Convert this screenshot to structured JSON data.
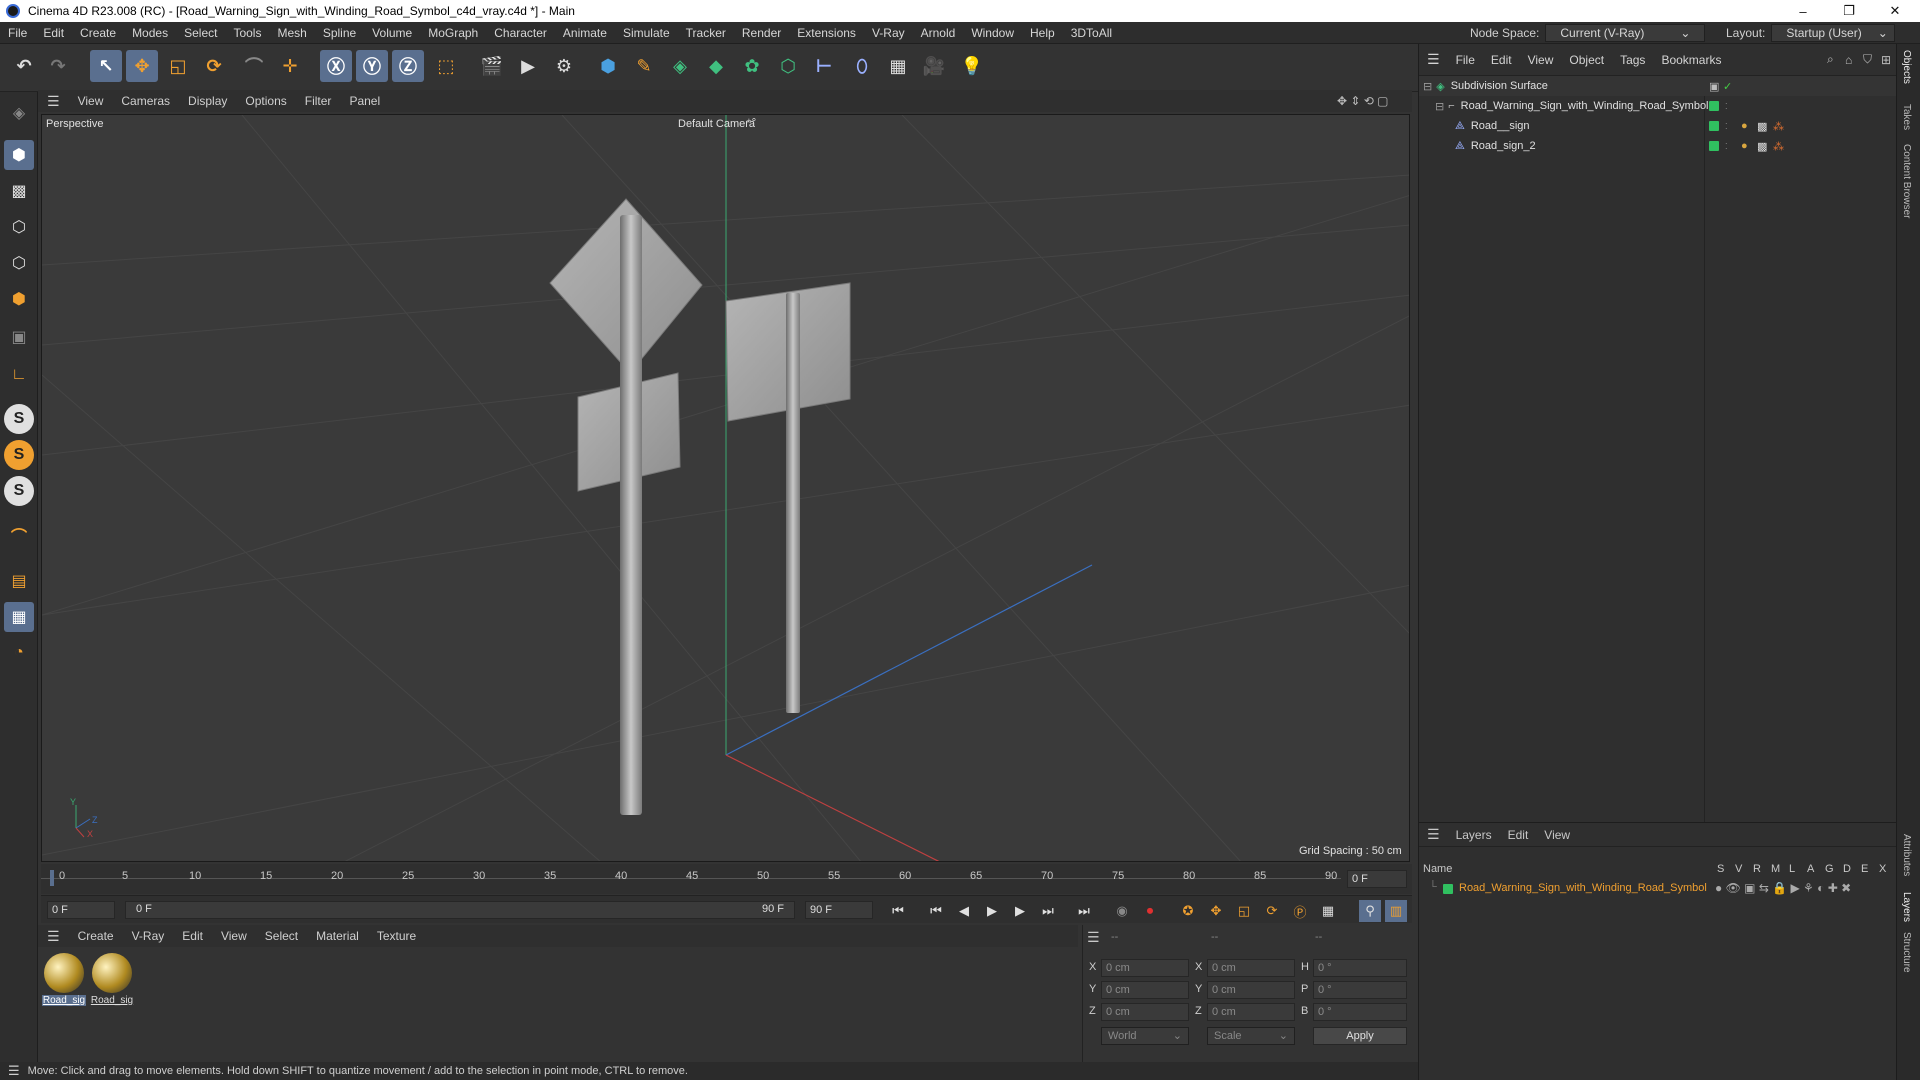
{
  "window": {
    "title": "Cinema 4D R23.008 (RC) - [Road_Warning_Sign_with_Winding_Road_Symbol_c4d_vray.c4d *] - Main",
    "minimize": "–",
    "maximize": "❐",
    "close": "✕"
  },
  "menu": [
    "File",
    "Edit",
    "Create",
    "Modes",
    "Select",
    "Tools",
    "Mesh",
    "Spline",
    "Volume",
    "MoGraph",
    "Character",
    "Animate",
    "Simulate",
    "Tracker",
    "Render",
    "Extensions",
    "V-Ray",
    "Arnold",
    "Window",
    "Help",
    "3DToAll"
  ],
  "node_space": {
    "label": "Node Space:",
    "value": "Current (V-Ray)"
  },
  "layout": {
    "label": "Layout:",
    "value": "Startup (User)"
  },
  "viewport": {
    "menu": [
      "View",
      "Cameras",
      "Display",
      "Options",
      "Filter",
      "Panel"
    ],
    "name": "Perspective",
    "camera": "Default Camera",
    "grid_spacing": "Grid Spacing : 50 cm",
    "axis_y": "Y",
    "axis_z": "Z",
    "axis_x": "X"
  },
  "timeline": {
    "ticks": [
      "0",
      "5",
      "10",
      "15",
      "20",
      "25",
      "30",
      "35",
      "40",
      "45",
      "50",
      "55",
      "60",
      "65",
      "70",
      "75",
      "80",
      "85",
      "90"
    ],
    "current_frame": "0 F"
  },
  "transport": {
    "start": "0 F",
    "range_start": "0 F",
    "range_end": "90 F",
    "end": "90 F"
  },
  "material_menu": [
    "Create",
    "V-Ray",
    "Edit",
    "View",
    "Select",
    "Material",
    "Texture"
  ],
  "materials": [
    {
      "label": "Road_sig",
      "selected": true
    },
    {
      "label": "Road_sig",
      "selected": false
    }
  ],
  "coords": {
    "header": [
      "--",
      "--",
      "--"
    ],
    "rows": [
      {
        "a": "X",
        "av": "0 cm",
        "b": "X",
        "bv": "0 cm",
        "c": "H",
        "cv": "0 °"
      },
      {
        "a": "Y",
        "av": "0 cm",
        "b": "Y",
        "bv": "0 cm",
        "c": "P",
        "cv": "0 °"
      },
      {
        "a": "Z",
        "av": "0 cm",
        "b": "Z",
        "bv": "0 cm",
        "c": "B",
        "cv": "0 °"
      }
    ],
    "space": "World",
    "mode": "Scale",
    "apply": "Apply"
  },
  "status": "Move: Click and drag to move elements. Hold down SHIFT to quantize movement / add to the selection in point mode, CTRL to remove.",
  "objects": {
    "menu": [
      "File",
      "Edit",
      "View",
      "Object",
      "Tags",
      "Bookmarks"
    ],
    "items": [
      {
        "name": "Subdivision Surface",
        "level": 0
      },
      {
        "name": "Road_Warning_Sign_with_Winding_Road_Symbol",
        "level": 1
      },
      {
        "name": "Road__sign",
        "level": 2
      },
      {
        "name": "Road_sign_2",
        "level": 2
      }
    ]
  },
  "layers": {
    "menu": [
      "Layers",
      "Edit",
      "View"
    ],
    "col_name": "Name",
    "cols": [
      "S",
      "V",
      "R",
      "M",
      "L",
      "A",
      "G",
      "D",
      "E",
      "X"
    ],
    "items": [
      {
        "name": "Road_Warning_Sign_with_Winding_Road_Symbol"
      }
    ]
  },
  "side_tabs": [
    "Objects",
    "Takes",
    "Content Browser",
    "Attributes",
    "Layers",
    "Structure"
  ],
  "colors": {
    "accent": "#5a6f8f",
    "layer_orange": "#f0a030",
    "green": "#30c060"
  }
}
